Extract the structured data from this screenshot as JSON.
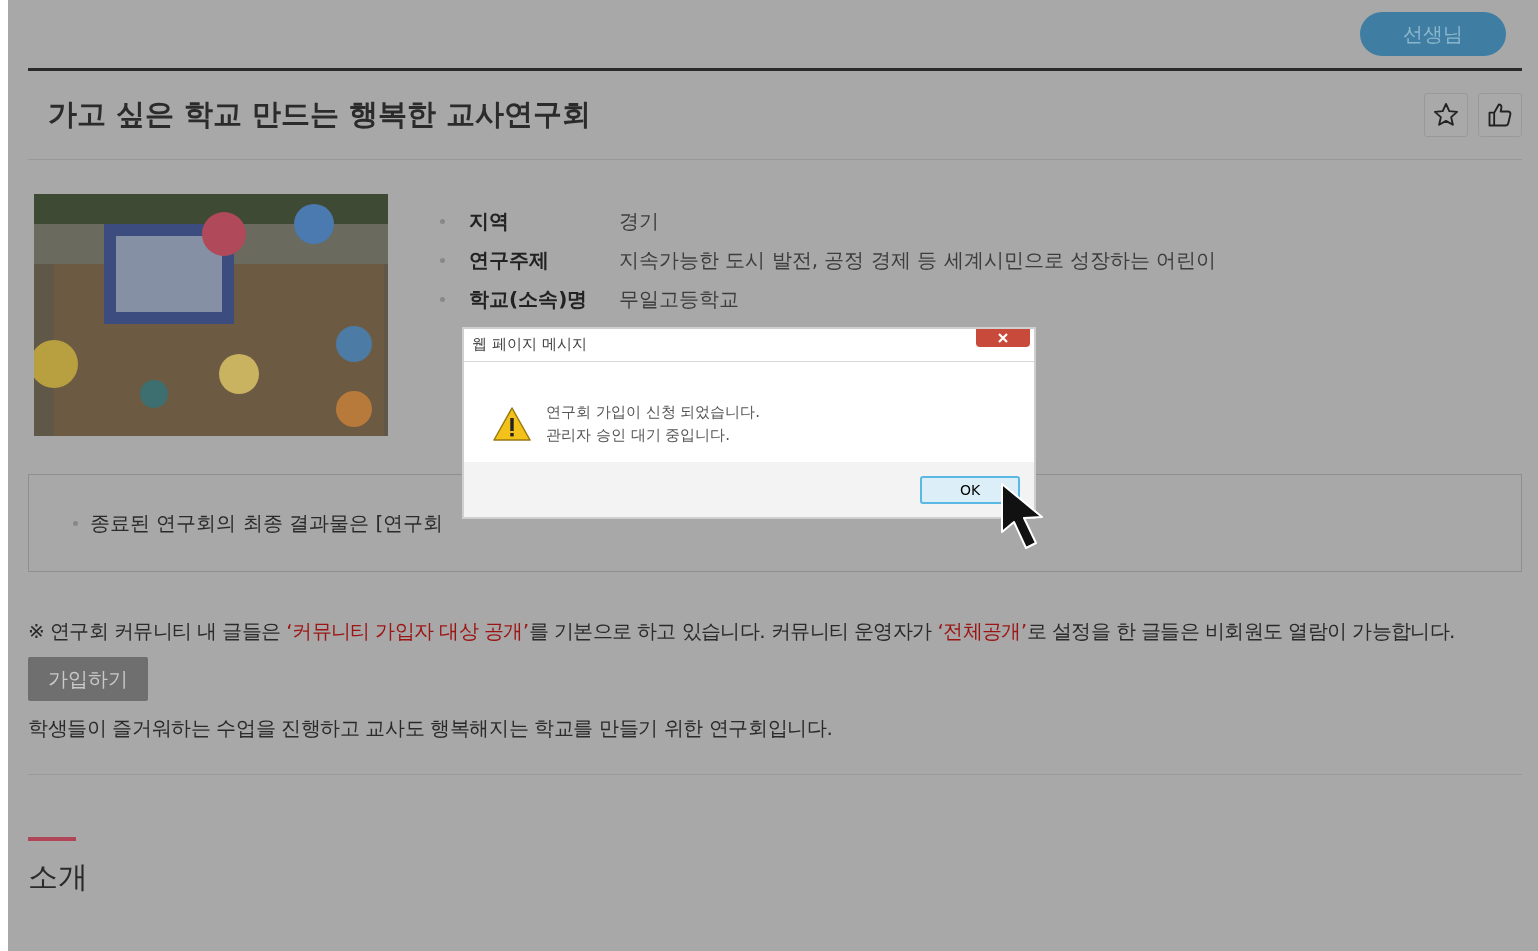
{
  "header": {
    "user_button": "선생님"
  },
  "title": "가고 싶은 학교 만드는 행복한 교사연구회",
  "actions": [
    {
      "kind": "star"
    },
    {
      "kind": "like"
    }
  ],
  "info": [
    {
      "label": "지역",
      "value": "경기"
    },
    {
      "label": "연구주제",
      "value": "지속가능한 도시 발전, 공정 경제 등 세계시민으로 성장하는 어린이"
    },
    {
      "label": "학교(소속)명",
      "value": "무일고등학교"
    }
  ],
  "notice": {
    "text": "종료된 연구회의 최종 결과물은 [연구회"
  },
  "policy": [
    {
      "text": "※ 연구회 커뮤니티 내 글들은 ",
      "highlight": false
    },
    {
      "text": "‘커뮤니티 가입자 대상 공개’",
      "highlight": true
    },
    {
      "text": "를 기본으로 하고 있습니다. 커뮤니티 운영자가 ",
      "highlight": false
    },
    {
      "text": "‘전체공개’",
      "highlight": true
    },
    {
      "text": "로 설정을 한 글들은 비회원도 열람이 가능합니다.",
      "highlight": false
    }
  ],
  "join_button": "가입하기",
  "description": "학생들이 즐거워하는 수업을 진행하고 교사도 행복해지는 학교를 만들기 위한 연구회입니다.",
  "section": {
    "title": "소개"
  },
  "dialog": {
    "title": "웹 페이지 메시지",
    "lines": [
      "연구회 가입이 신청 되었습니다.",
      "관리자 승인 대기 중입니다."
    ],
    "ok": "OK"
  }
}
